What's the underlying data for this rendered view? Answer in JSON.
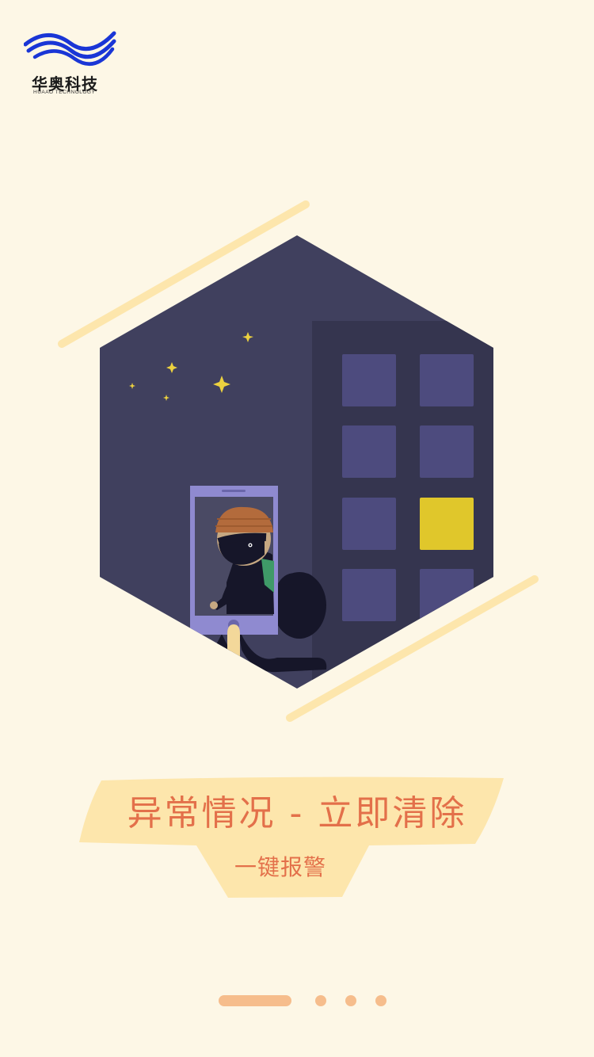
{
  "brand": {
    "name": "华奥科技",
    "subtitle": "HUAAO TECHNOLOGY",
    "logo_color": "#1a36d6"
  },
  "banner": {
    "headline": "异常情况 - 立即清除",
    "subline": "一键报警",
    "text_color": "#e3704a",
    "ribbon_color": "#fde6ac"
  },
  "illustration": {
    "icon": "thief-at-night-illustration",
    "moon_color": "#ecd13f",
    "lit_window_color": "#e0c72b"
  },
  "pager": {
    "total": 4,
    "active_index": 0
  }
}
